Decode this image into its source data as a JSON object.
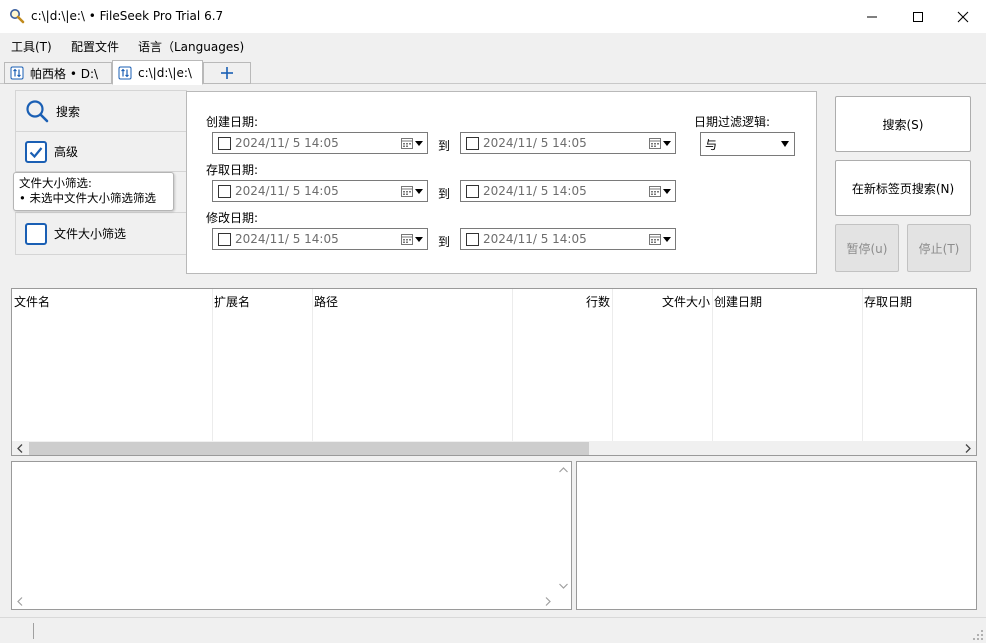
{
  "window": {
    "title": "c:\\|d:\\|e:\\ • FileSeek Pro Trial 6.7"
  },
  "menu": {
    "items": [
      {
        "label": "工具(T)"
      },
      {
        "label": "配置文件"
      },
      {
        "label": "语言（Languages)"
      }
    ]
  },
  "tabs": [
    {
      "label": "帕西格 • D:\\",
      "icon": "search-tab-icon"
    },
    {
      "label": "c:\\|d:\\|e:\\",
      "icon": "search-tab-icon",
      "active": true
    }
  ],
  "nav": {
    "search": "搜索",
    "advanced": "高级",
    "filesize": "文件大小筛选"
  },
  "tooltip": {
    "title": "文件大小筛选:",
    "line": "• 未选中文件大小筛选筛选"
  },
  "dates": {
    "created_label": "创建日期:",
    "accessed_label": "存取日期:",
    "modified_label": "修改日期:",
    "to_label": "到",
    "placeholder": "2024/11/  5 14:05",
    "logic_label": "日期过滤逻辑:",
    "logic_value": "与"
  },
  "buttons": {
    "search": "搜索(S)",
    "search_new_tab": "在新标签页搜索(N)",
    "pause": "暂停(u)",
    "stop": "停止(T)"
  },
  "table": {
    "columns": [
      "文件名",
      "扩展名",
      "路径",
      "行数",
      "文件大小",
      "创建日期",
      "存取日期"
    ]
  },
  "colors": {
    "accent": "#1a5fb4",
    "window_bg": "#f0f0f0"
  }
}
